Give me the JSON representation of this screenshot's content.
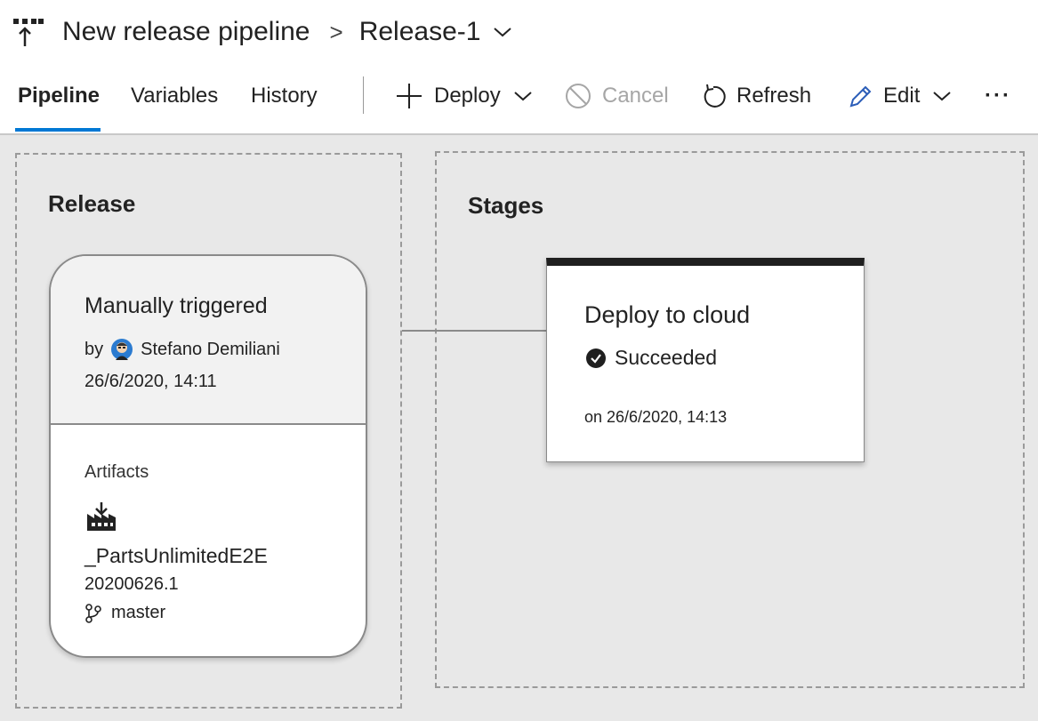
{
  "header": {
    "pipeline_name": "New release pipeline",
    "breadcrumb_separator": ">",
    "release_name": "Release-1"
  },
  "tabs": [
    {
      "label": "Pipeline",
      "active": true
    },
    {
      "label": "Variables",
      "active": false
    },
    {
      "label": "History",
      "active": false
    }
  ],
  "commands": {
    "deploy": "Deploy",
    "cancel": "Cancel",
    "refresh": "Refresh",
    "edit": "Edit",
    "more": "···"
  },
  "release_section": {
    "title": "Release",
    "trigger": "Manually triggered",
    "by_label": "by",
    "user": "Stefano Demiliani",
    "timestamp": "26/6/2020, 14:11",
    "artifacts_label": "Artifacts",
    "artifact_name": "_PartsUnlimitedE2E",
    "artifact_version": "20200626.1",
    "branch": "master"
  },
  "stages_section": {
    "title": "Stages",
    "stage_name": "Deploy to cloud",
    "status": "Succeeded",
    "completed_on": "on 26/6/2020, 14:13"
  },
  "colors": {
    "accent": "#0078d4",
    "canvas": "#e8e8e8",
    "stage_top_bar": "#1f1f1f",
    "disabled": "#a6a6a6"
  },
  "icons": {
    "pipeline": "release-pipeline-icon",
    "deploy": "plus-icon",
    "cancel": "cancel-circle-icon",
    "refresh": "refresh-icon",
    "edit": "pencil-icon",
    "status": "check-circle-icon",
    "artifact": "build-artifact-icon",
    "branch": "git-branch-icon"
  }
}
